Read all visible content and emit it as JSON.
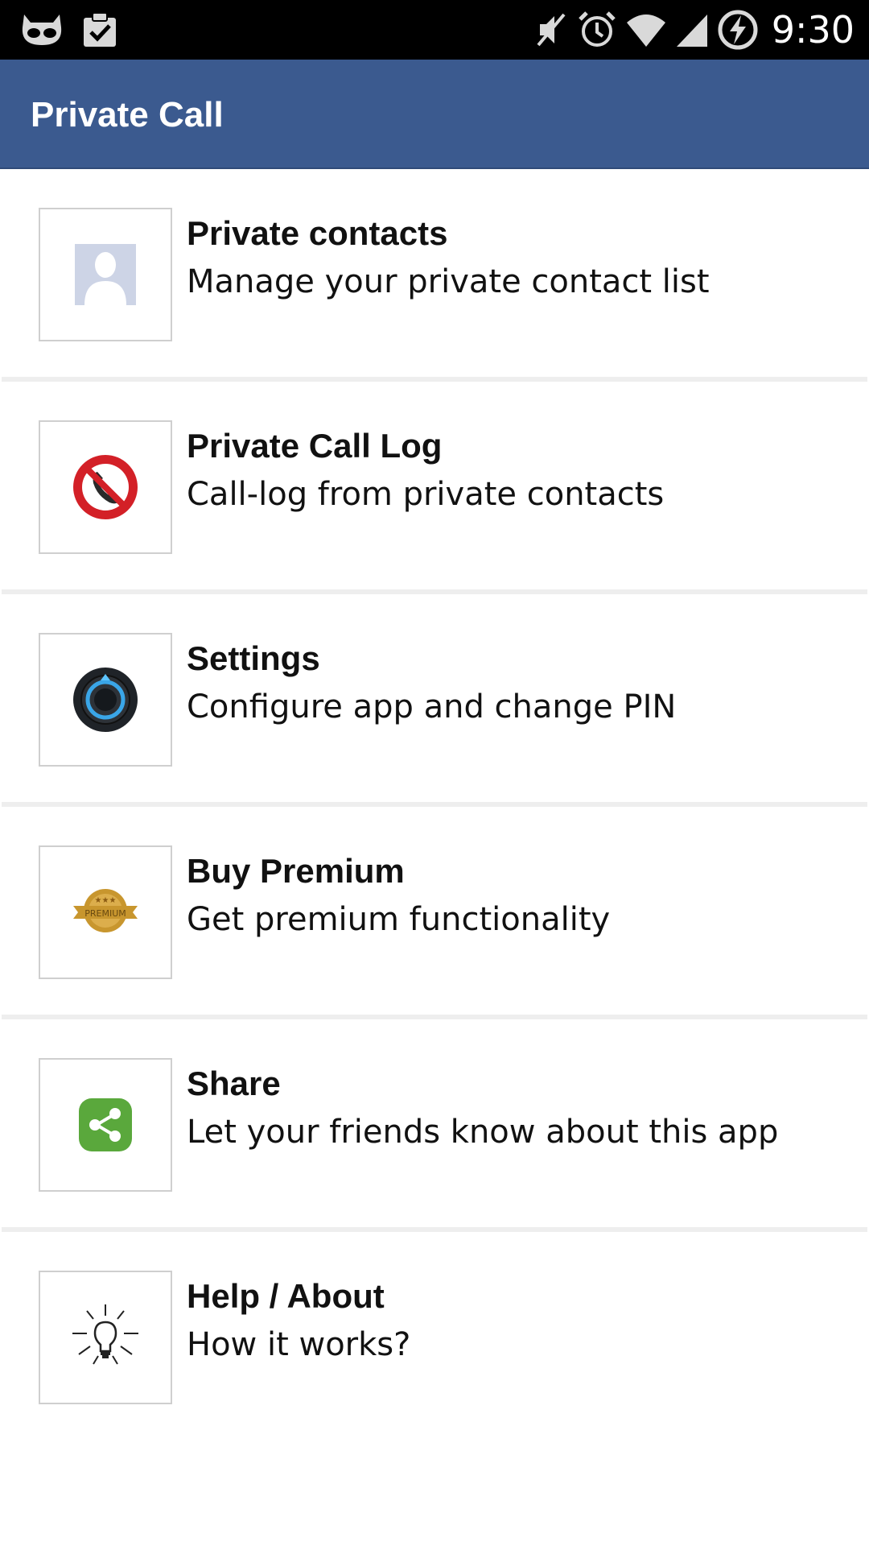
{
  "status_bar": {
    "time": "9:30",
    "icons": [
      "android-face-icon",
      "clipboard-check-icon",
      "mute-icon",
      "alarm-icon",
      "wifi-icon",
      "signal-icon",
      "battery-charging-icon"
    ]
  },
  "app_bar": {
    "title": "Private Call",
    "color": "#3b5a8f"
  },
  "menu": {
    "items": [
      {
        "title": "Private contacts",
        "subtitle": "Manage your private contact list",
        "icon": "contact-silhouette-icon"
      },
      {
        "title": "Private Call Log",
        "subtitle": "Call-log from private contacts",
        "icon": "no-call-icon"
      },
      {
        "title": "Settings",
        "subtitle": "Configure app and change PIN",
        "icon": "settings-knob-icon"
      },
      {
        "title": "Buy Premium",
        "subtitle": "Get premium functionality",
        "icon": "premium-badge-icon"
      },
      {
        "title": "Share",
        "subtitle": "Let your friends know about this app",
        "icon": "share-icon"
      },
      {
        "title": "Help / About",
        "subtitle": "How it works?",
        "icon": "lightbulb-icon"
      }
    ]
  },
  "colors": {
    "app_bar": "#3b5a8f",
    "no_call_red": "#d32027",
    "share_green": "#5aa83c",
    "premium_gold": "#c8962e"
  }
}
